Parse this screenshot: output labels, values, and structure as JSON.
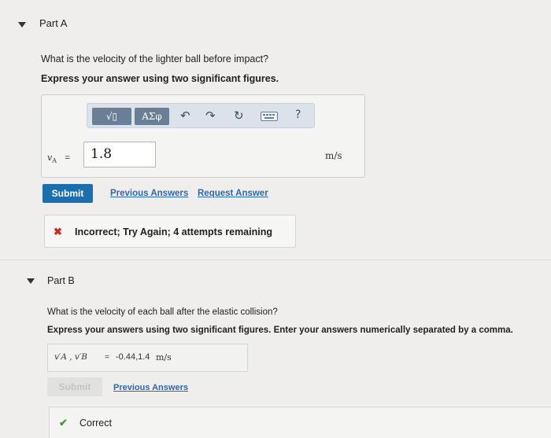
{
  "part_a": {
    "title": "Part A",
    "question": "What is the velocity of the lighter ball before impact?",
    "instruction": "Express your answer using two significant figures.",
    "toolbar": {
      "template_button": "√▯",
      "greek_button": "ΑΣφ",
      "help": "?"
    },
    "variable": "v",
    "variable_sub": "A",
    "equals": "=",
    "input_value": "1.8",
    "unit": "m/s",
    "submit_label": "Submit",
    "previous_answers_link": "Previous Answers",
    "request_answer_link": "Request Answer",
    "feedback": {
      "symbol": "✖",
      "text": "Incorrect; Try Again; 4 attempts remaining"
    }
  },
  "part_b": {
    "title": "Part B",
    "question": "What is the velocity of each ball after the elastic collision?",
    "instruction": "Express your answers using two significant figures. Enter your answers numerically separated by a comma.",
    "variables": "v′A , v′B",
    "equals": "=",
    "answer_value": "-0.44,1.4",
    "unit": "m/s",
    "submit_label": "Submit",
    "previous_answers_link": "Previous Answers",
    "result": {
      "symbol": "✔",
      "text": "Correct"
    }
  },
  "colors": {
    "accent": "#1b6fae",
    "link": "#2d68b3",
    "incorrect": "#d0281e",
    "correct": "#4a9a3a",
    "toolbar_bg": "#dbe2ea",
    "toolbar_btn": "#6a7f95"
  },
  "icons": {
    "collapse": "caret-down-icon",
    "undo": "undo-icon",
    "redo": "redo-icon",
    "reset": "reset-icon",
    "keyboard": "keyboard-icon",
    "help": "help-icon",
    "incorrect": "x-mark-icon",
    "correct": "check-mark-icon"
  }
}
